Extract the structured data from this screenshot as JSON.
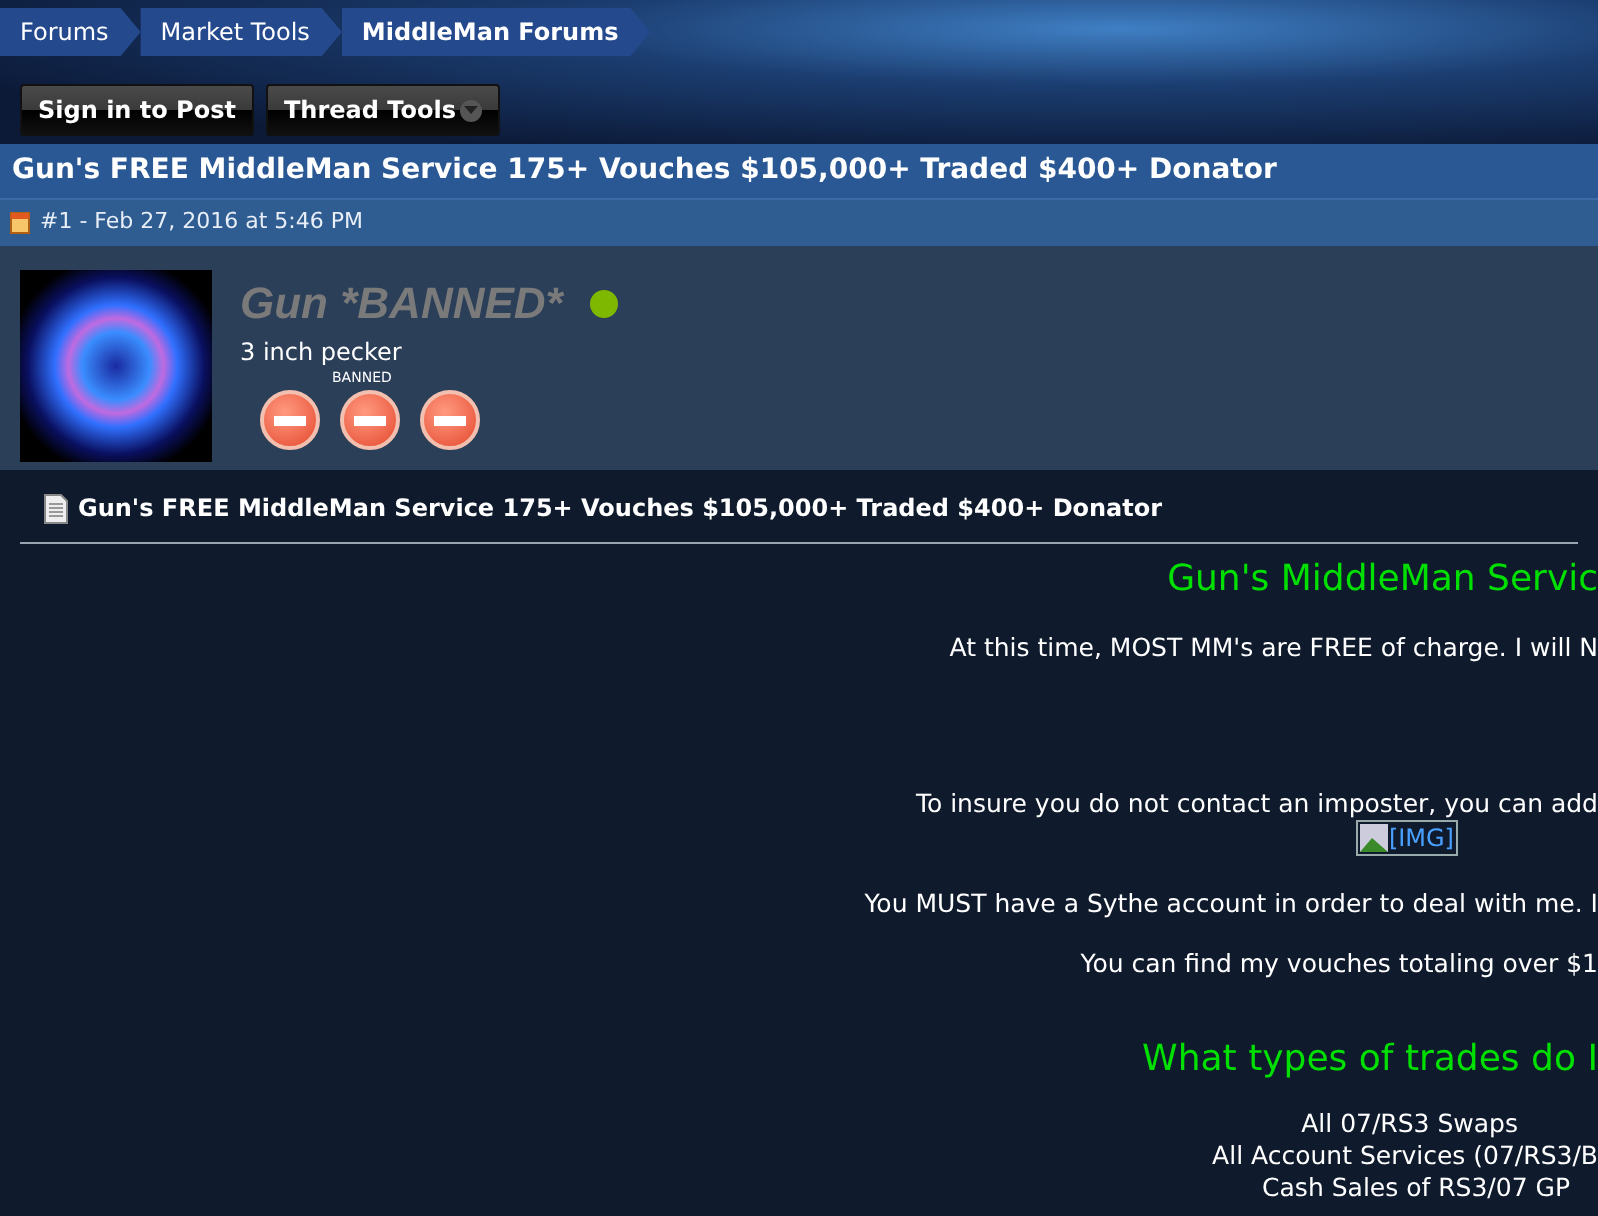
{
  "breadcrumbs": [
    {
      "label": "Forums",
      "selected": false
    },
    {
      "label": "Market Tools",
      "selected": false
    },
    {
      "label": "MiddleMan Forums",
      "selected": true
    }
  ],
  "buttons": [
    {
      "label": "Sign in to Post",
      "kind": "plain"
    },
    {
      "label": "Thread Tools",
      "kind": "dropdown"
    }
  ],
  "thread_title": "Gun's FREE MiddleMan Service 175+ Vouches $105,000+ Traded $400+ Donator",
  "post": {
    "number": "#1 - Feb 27, 2016 at 5:46 PM",
    "user": {
      "name": "Gun *BANNED*",
      "online": true,
      "user_title": "3 inch pecker",
      "badge_label": "BANNED",
      "badges": [
        {
          "kind": "no-entry"
        },
        {
          "kind": "no-entry"
        },
        {
          "kind": "no-entry"
        }
      ]
    },
    "title": "Gun's FREE MiddleMan Service 175+ Vouches $105,000+ Traded $400+ Donator",
    "body": [
      {
        "kind": "heading",
        "text": "Gun's MiddleMan Servic"
      },
      {
        "kind": "line",
        "text": "At this time, MOST MM's are FREE of charge. I will N"
      },
      {
        "kind": "line",
        "text": "To insure you do not contact an imposter, you can add"
      },
      {
        "kind": "image",
        "text": "[IMG]"
      },
      {
        "kind": "line",
        "text": "You MUST have a Sythe account in order to deal with me. I"
      },
      {
        "kind": "line",
        "text": "You can find my vouches totaling over $1"
      },
      {
        "kind": "heading",
        "text": "What types of trades do I"
      },
      {
        "kind": "line",
        "text": "All 07/RS3 Swaps"
      },
      {
        "kind": "line",
        "text": "All Account Services (07/RS3/B"
      },
      {
        "kind": "line",
        "text": "Cash Sales of RS3/07 GP"
      }
    ]
  }
}
